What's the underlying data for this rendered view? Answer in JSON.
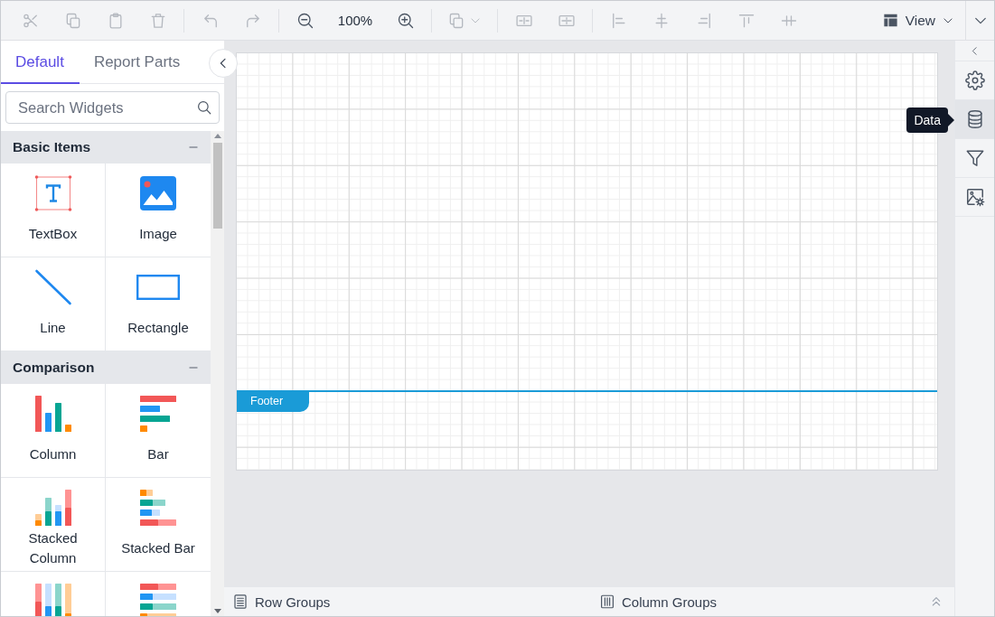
{
  "toolbar": {
    "groups": [
      [
        {
          "kind": "button",
          "disabled": true
        },
        {
          "kind": "button",
          "disabled": true
        },
        {
          "kind": "button",
          "disabled": true
        },
        {
          "kind": "button",
          "disabled": true
        }
      ],
      [
        {
          "kind": "button",
          "disabled": true
        },
        {
          "kind": "button",
          "disabled": true
        }
      ],
      [
        {
          "kind": "button",
          "disabled": false
        },
        {
          "kind": "zoom-level",
          "text": "100%"
        },
        {
          "kind": "button",
          "disabled": false
        }
      ],
      [
        {
          "kind": "dropdown",
          "disabled": true
        }
      ],
      [
        {
          "kind": "button",
          "disabled": true
        },
        {
          "kind": "button",
          "disabled": true
        }
      ],
      [
        {
          "kind": "button",
          "disabled": true
        },
        {
          "kind": "button",
          "disabled": true
        },
        {
          "kind": "button",
          "disabled": true
        },
        {
          "kind": "button",
          "disabled": true
        },
        {
          "kind": "button",
          "disabled": true
        }
      ]
    ],
    "view_menu": {
      "label": "View"
    }
  },
  "widget_panel": {
    "tabs": [
      {
        "label": "Default",
        "selected": true
      },
      {
        "label": "Report Parts",
        "selected": false
      }
    ],
    "search": {
      "placeholder": "Search Widgets"
    },
    "sections": [
      {
        "title": "Basic Items",
        "expanded": true,
        "items": [
          {
            "kind": "text-box",
            "label": "TextBox"
          },
          {
            "kind": "image",
            "label": "Image"
          },
          {
            "kind": "line",
            "label": "Line"
          },
          {
            "kind": "rectangle",
            "label": "Rectangle"
          }
        ]
      },
      {
        "title": "Comparison",
        "expanded": true,
        "items": [
          {
            "kind": "column",
            "label": "Column"
          },
          {
            "kind": "bar",
            "label": "Bar"
          },
          {
            "kind": "stacked-column",
            "label": "Stacked Column"
          },
          {
            "kind": "stacked-bar",
            "label": "Stacked Bar"
          },
          {
            "kind": "full-stacked-column"
          },
          {
            "kind": "full-stacked-bar"
          }
        ]
      }
    ]
  },
  "design_surface": {
    "footer": {
      "label": "Footer"
    }
  },
  "group_bar": {
    "row_groups": {
      "label": "Row Groups"
    },
    "column_groups": {
      "label": "Column Groups"
    },
    "expanded": false
  },
  "side_bar": {
    "items": [
      {
        "selected": false
      },
      {
        "selected": true,
        "tooltip": "Data"
      },
      {
        "selected": false
      },
      {
        "selected": false
      }
    ]
  }
}
